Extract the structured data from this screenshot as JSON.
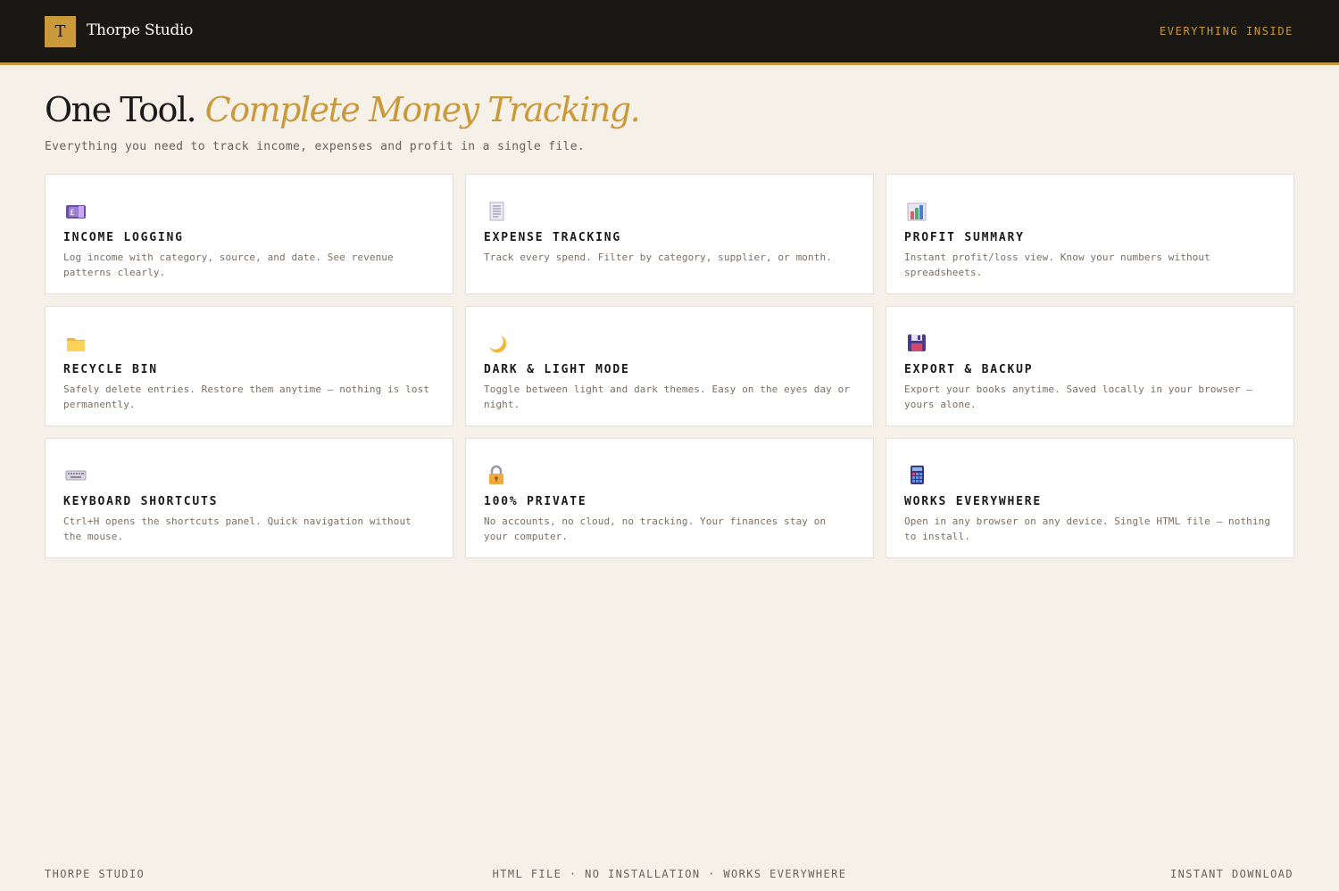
{
  "header": {
    "logo_letter": "T",
    "brand_name": "Thorpe Studio",
    "nav_link": "EVERYTHING INSIDE"
  },
  "hero": {
    "title_plain": "One Tool. ",
    "title_accent": "Complete Money Tracking.",
    "subtitle": "Everything you need to track income, expenses and profit in a single file."
  },
  "features": [
    {
      "icon": "money-icon",
      "title": "INCOME LOGGING",
      "description": "Log income with category, source, and date. See revenue patterns clearly."
    },
    {
      "icon": "receipt-icon",
      "title": "EXPENSE TRACKING",
      "description": "Track every spend. Filter by category, supplier, or month."
    },
    {
      "icon": "bar-chart-icon",
      "title": "PROFIT SUMMARY",
      "description": "Instant profit/loss view. Know your numbers without spreadsheets."
    },
    {
      "icon": "folder-icon",
      "title": "RECYCLE BIN",
      "description": "Safely delete entries. Restore them anytime — nothing is lost permanently."
    },
    {
      "icon": "moon-icon",
      "title": "DARK & LIGHT MODE",
      "description": "Toggle between light and dark themes. Easy on the eyes day or night."
    },
    {
      "icon": "floppy-disk-icon",
      "title": "EXPORT & BACKUP",
      "description": "Export your books anytime. Saved locally in your browser — yours alone."
    },
    {
      "icon": "keyboard-icon",
      "title": "KEYBOARD SHORTCUTS",
      "description": "Ctrl+H opens the shortcuts panel. Quick navigation without the mouse."
    },
    {
      "icon": "lock-icon",
      "title": "100% PRIVATE",
      "description": "No accounts, no cloud, no tracking. Your finances stay on your computer."
    },
    {
      "icon": "calculator-icon",
      "title": "WORKS EVERYWHERE",
      "description": "Open in any browser on any device. Single HTML file — nothing to install."
    }
  ],
  "footer": {
    "left": "THORPE STUDIO",
    "center": "HTML FILE · NO INSTALLATION · WORKS EVERYWHERE",
    "right": "INSTANT DOWNLOAD"
  },
  "colors": {
    "accent": "#c9993a",
    "header_bg": "#1a1815",
    "page_bg": "#f5f0e8",
    "card_bg": "#ffffff"
  }
}
